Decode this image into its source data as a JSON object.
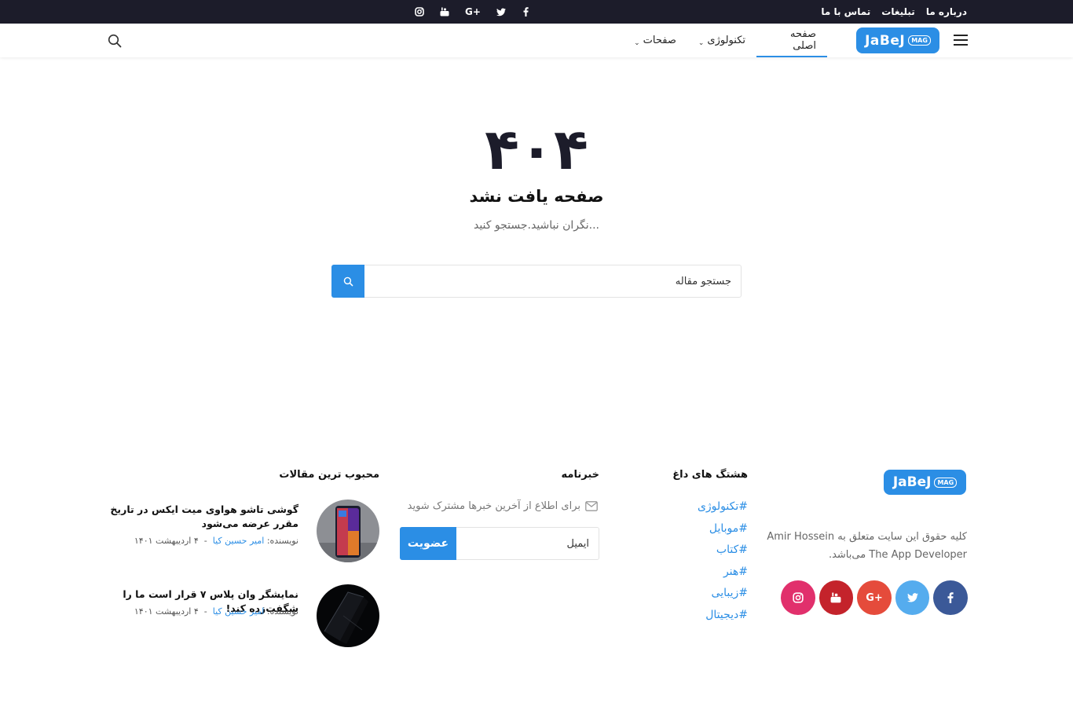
{
  "topbar": {
    "links": [
      "درباره ما",
      "تبلیغات",
      "تماس با ما"
    ],
    "social_icons": [
      "facebook-icon",
      "twitter-icon",
      "google-plus-icon",
      "youtube-icon",
      "instagram-icon"
    ],
    "google_label": "G+"
  },
  "navbar": {
    "logo_text": "JaBeJ",
    "logo_mark": "MAG",
    "menu": [
      {
        "label": "صفحه اصلی",
        "active": true
      },
      {
        "label": "تکنولوژی",
        "has_dropdown": true
      },
      {
        "label": "صفحات",
        "has_dropdown": true
      }
    ]
  },
  "error": {
    "code": "۴۰۴",
    "title": "صفحه یافت نشد",
    "subtitle": "نگران نباشید.جستجو کنید...",
    "search_placeholder": "جستجو مقاله"
  },
  "footer": {
    "about": {
      "logo_text": "JaBeJ",
      "logo_mark": "MAG",
      "copyright": "کلیه حقوق این سایت متعلق به Amir Hossein The App Developer می‌باشد.",
      "socials": [
        {
          "name": "facebook-icon",
          "color": "#3b5998",
          "glyph": "f"
        },
        {
          "name": "twitter-icon",
          "color": "#55acee",
          "glyph": "t"
        },
        {
          "name": "google-plus-icon",
          "color": "#e54b3b",
          "glyph": "G+"
        },
        {
          "name": "youtube-icon",
          "color": "#c4232b",
          "glyph": "▶"
        },
        {
          "name": "instagram-icon",
          "color": "#e1306c",
          "glyph": "◎"
        }
      ]
    },
    "hashtags": {
      "title": "هشتگ های داغ",
      "tags": [
        "#تکنولوژی",
        "#موبایل",
        "#کتاب",
        "#هنر",
        "#زیبایی",
        "#دیجیتال"
      ]
    },
    "newsletter": {
      "title": "خبرنامه",
      "text": "برای اطلاع از آخرین خبرها مشترک شوید",
      "placeholder": "ایمیل",
      "button": "عضویت"
    },
    "popular": {
      "title": "محبوب ترین مقالات",
      "posts": [
        {
          "title": "گوشی تاشو هواوی میت ایکس در تاریخ مقرر عرضه می‌شود",
          "author_label": "نویسنده:",
          "author": "امیر حسین کیا",
          "separator": "-",
          "date": "۴ اردیبهشت ۱۴۰۱"
        },
        {
          "title": "نمایشگر وان پلاس ۷ قرار است ما را شگفت‌زده کند!",
          "author_label": "نویسنده:",
          "author": "امیر حسین کیا",
          "separator": "-",
          "date": "۴ اردیبهشت ۱۴۰۱"
        }
      ]
    }
  }
}
